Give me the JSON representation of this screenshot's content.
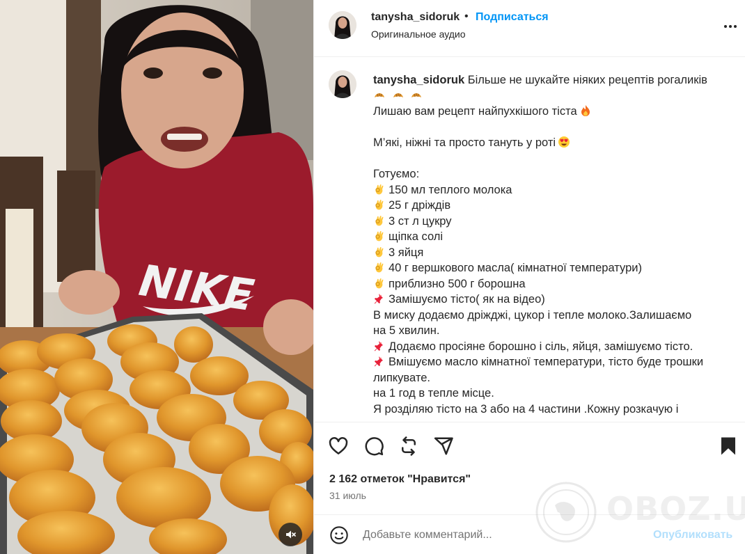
{
  "header": {
    "username": "tanysha_sidoruk",
    "dot": "•",
    "follow_label": "Подписаться",
    "audio": "Оригинальное аудио"
  },
  "caption": {
    "username": "tanysha_sidoruk",
    "first_text": "Більше не шукайте ніяких рецептів рогаликів",
    "lines": [
      {
        "emoji": "🔥",
        "text": "Лишаю вам рецепт найпухкішого тіста",
        "emoji_after": true
      },
      {
        "text": ""
      },
      {
        "emoji": "😍",
        "text": "М’які, ніжні та просто тануть у роті",
        "emoji_after": true
      },
      {
        "text": ""
      },
      {
        "text": "Готуємо:"
      },
      {
        "emoji": "👌",
        "text": "150 мл теплого молока"
      },
      {
        "emoji": "👌",
        "text": "25 г дріждів"
      },
      {
        "emoji": "👌",
        "text": "3 ст л цукру"
      },
      {
        "emoji": "👌",
        "text": "щіпка солі"
      },
      {
        "emoji": "👌",
        "text": "3 яйця"
      },
      {
        "emoji": "👌",
        "text": "40 г вершкового масла( кімнатної температури)"
      },
      {
        "emoji": "👌",
        "text": "приблизно 500 г борошна"
      },
      {
        "emoji": "📌",
        "text": "Замішуємо тісто( як на відео)"
      },
      {
        "text": "В миску додаємо дріжджі, цукор і тепле молоко.Залишаємо"
      },
      {
        "text": "на 5 хвилин."
      },
      {
        "emoji": "📌",
        "text": "Додаємо просіяне борошно і сіль, яйця, замішуємо тісто."
      },
      {
        "emoji": "📌",
        "text": "Вмішуємо масло кімнатної температури, тісто буде трошки"
      },
      {
        "text": "липкувате."
      },
      {
        "text": "на 1 год в тепле місце."
      },
      {
        "text": "Я розділяю тісто на 3 або на 4 частини .Кожну розкачую і"
      }
    ]
  },
  "actions": {
    "like_icon": "heart-icon",
    "comment_icon": "comment-icon",
    "repost_icon": "repost-icon",
    "share_icon": "share-icon",
    "save_icon": "bookmark-icon",
    "likes": "2 162 отметок \"Нравится\"",
    "date": "31 июль"
  },
  "comment": {
    "placeholder": "Добавьте комментарий...",
    "publish_label": "Опубликовать"
  },
  "watermark": {
    "text": "OBOZ.UA"
  },
  "colors": {
    "accent": "#0095f6",
    "publish_disabled": "#b2dffc",
    "text": "#262626",
    "muted": "#737373"
  }
}
